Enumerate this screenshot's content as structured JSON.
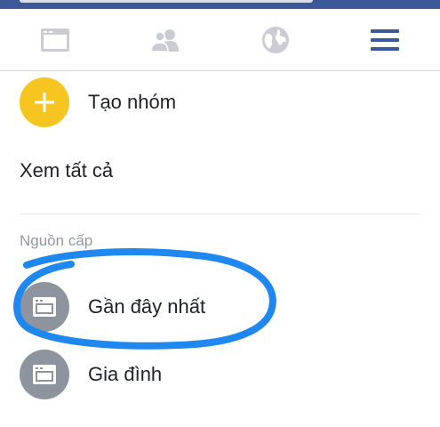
{
  "tabbar": {
    "tabs": [
      {
        "icon": "news-feed-icon"
      },
      {
        "icon": "friends-icon"
      },
      {
        "icon": "globe-icon"
      },
      {
        "icon": "menu-icon"
      }
    ],
    "colors": {
      "inactive": "#c9ccd2",
      "active": "#3b5998"
    }
  },
  "groups": {
    "create_label": "Tạo nhóm",
    "create_icon": "plus-icon",
    "create_color": "#f7c520",
    "see_all_label": "Xem tất cả"
  },
  "feeds": {
    "header": "Nguồn cấp",
    "items": [
      {
        "label": "Gần đây nhất",
        "icon": "feed-icon"
      },
      {
        "label": "Gia đình",
        "icon": "feed-icon"
      }
    ],
    "icon_bg": "#8d949e"
  },
  "annotation": {
    "color": "#1e88f0"
  }
}
